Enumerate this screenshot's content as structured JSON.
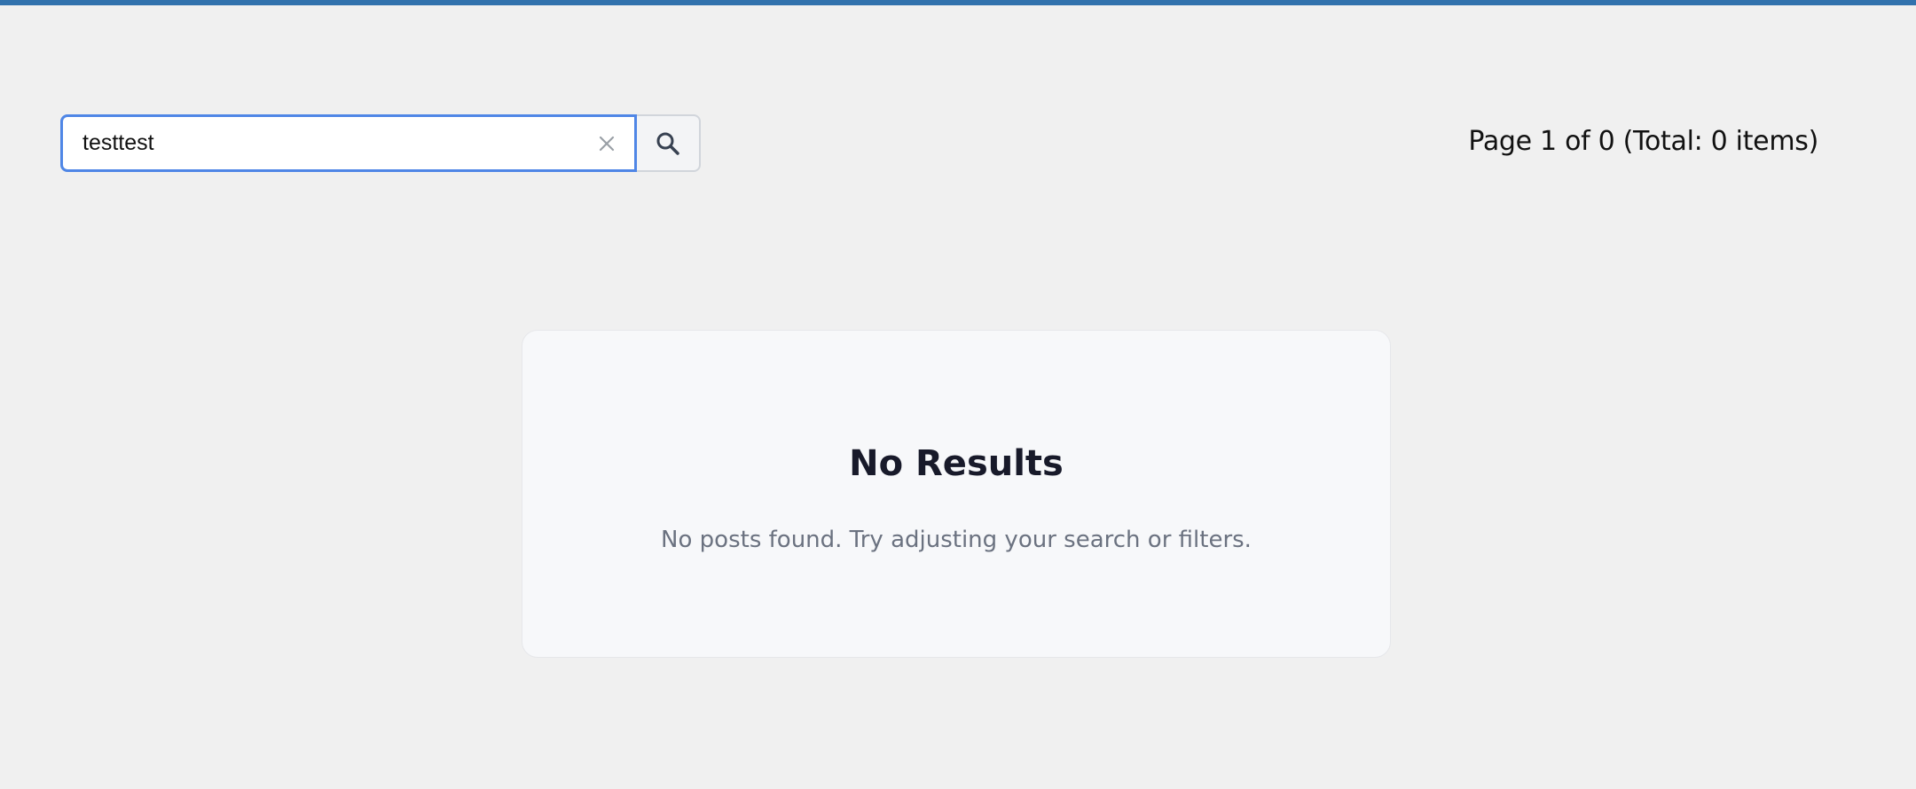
{
  "search": {
    "value": "testtest",
    "clear_icon": "close-icon",
    "submit_icon": "search-icon"
  },
  "pagination": {
    "text": "Page 1 of 0 (Total: 0 items)"
  },
  "empty_state": {
    "title": "No Results",
    "message": "No posts found. Try adjusting your search or filters."
  },
  "colors": {
    "accent": "#3172ad",
    "focus_border": "#4f86e6",
    "background": "#f0f0f0",
    "card_background": "#f7f8fa",
    "title_text": "#181a2a",
    "muted_text": "#6b7280"
  }
}
